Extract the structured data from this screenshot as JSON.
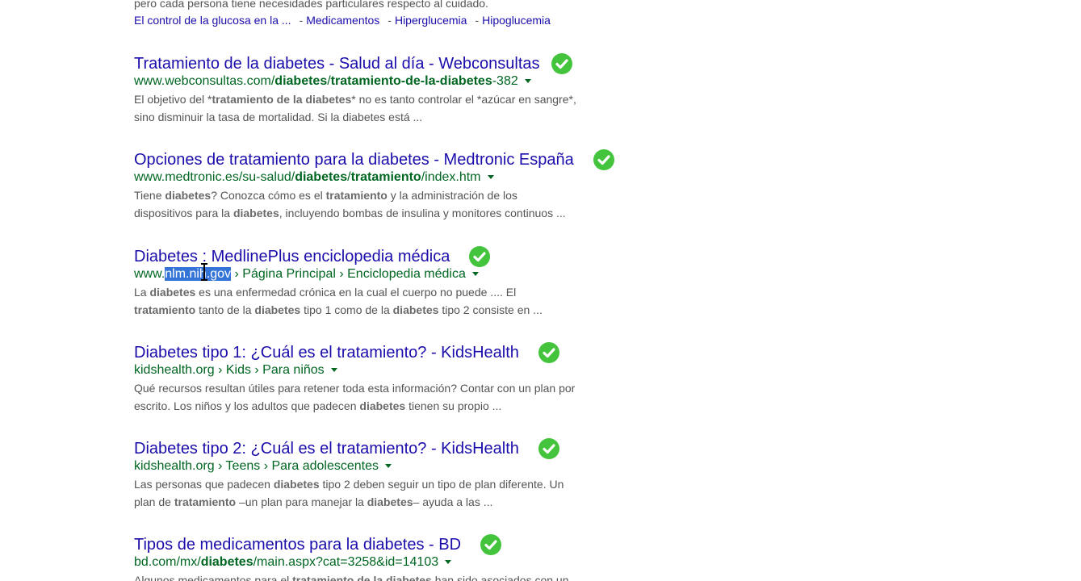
{
  "top_partial": {
    "snippet_line": "pero cada persona tiene necesidades particulares respecto al cuidado.",
    "sitelinks": [
      "El control de la glucosa en la ...",
      "Medicamentos",
      "Hiperglucemia",
      "Hipoglucemia"
    ]
  },
  "check_icon_color": "#44c43c",
  "results": [
    {
      "title": "Tratamiento de la diabetes - Salud al día - Webconsultas",
      "url": [
        {
          "t": "www.webconsultas.com/",
          "b": false
        },
        {
          "t": "diabetes",
          "b": true
        },
        {
          "t": "/",
          "b": false
        },
        {
          "t": "tratamiento-de-la-diabetes",
          "b": true
        },
        {
          "t": "-382",
          "b": false
        }
      ],
      "snippet": [
        [
          {
            "t": "El objetivo del *",
            "b": false
          },
          {
            "t": "tratamiento de la diabetes",
            "b": true
          },
          {
            "t": "* no es tanto controlar el *azúcar en sangre*,",
            "b": false
          }
        ],
        [
          {
            "t": "sino disminuir la tasa de mortalidad. Si la diabetes está ...",
            "b": false
          }
        ]
      ]
    },
    {
      "title": "Opciones de tratamiento para la diabetes - Medtronic España",
      "url": [
        {
          "t": "www.medtronic.es/su-salud/",
          "b": false
        },
        {
          "t": "diabetes",
          "b": true
        },
        {
          "t": "/",
          "b": false
        },
        {
          "t": "tratamiento",
          "b": true
        },
        {
          "t": "/index.htm",
          "b": false
        }
      ],
      "snippet": [
        [
          {
            "t": "Tiene ",
            "b": false
          },
          {
            "t": "diabetes",
            "b": true
          },
          {
            "t": "? Conozca cómo es el ",
            "b": false
          },
          {
            "t": "tratamiento",
            "b": true
          },
          {
            "t": " y la administración de los",
            "b": false
          }
        ],
        [
          {
            "t": "dispositivos para la ",
            "b": false
          },
          {
            "t": "diabetes",
            "b": true
          },
          {
            "t": ", incluyendo bombas de insulina y monitores continuos ...",
            "b": false
          }
        ]
      ]
    },
    {
      "title": "Diabetes : MedlinePlus enciclopedia médica",
      "url_prefix": "www.",
      "url_selected": "nlm.nih.gov",
      "url_crumbs": " › Página Principal › Enciclopedia médica",
      "snippet": [
        [
          {
            "t": "La ",
            "b": false
          },
          {
            "t": "diabetes",
            "b": true
          },
          {
            "t": " es una enfermedad crónica en la cual el cuerpo no puede .... El",
            "b": false
          }
        ],
        [
          {
            "t": "tratamiento",
            "b": true
          },
          {
            "t": " tanto de la ",
            "b": false
          },
          {
            "t": "diabetes",
            "b": true
          },
          {
            "t": " tipo 1 como de la ",
            "b": false
          },
          {
            "t": "diabetes",
            "b": true
          },
          {
            "t": " tipo 2 consiste en ...",
            "b": false
          }
        ]
      ]
    },
    {
      "title": "Diabetes tipo 1: ¿Cuál es el tratamiento? - KidsHealth",
      "url": [
        {
          "t": "kidshealth.org › Kids › Para niños",
          "b": false
        }
      ],
      "snippet": [
        [
          {
            "t": "Qué recursos resultan útiles para retener toda esta información? Contar con un plan por",
            "b": false
          }
        ],
        [
          {
            "t": "escrito. Los niños y los adultos que padecen ",
            "b": false
          },
          {
            "t": "diabetes",
            "b": true
          },
          {
            "t": " tienen su propio ...",
            "b": false
          }
        ]
      ]
    },
    {
      "title": "Diabetes tipo 2: ¿Cuál es el tratamiento? - KidsHealth",
      "url": [
        {
          "t": "kidshealth.org › Teens › Para adolescentes",
          "b": false
        }
      ],
      "snippet": [
        [
          {
            "t": "Las personas que padecen ",
            "b": false
          },
          {
            "t": "diabetes",
            "b": true
          },
          {
            "t": " tipo 2 deben seguir un tipo de plan diferente. Un",
            "b": false
          }
        ],
        [
          {
            "t": "plan de ",
            "b": false
          },
          {
            "t": "tratamiento",
            "b": true
          },
          {
            "t": " –un plan para manejar la ",
            "b": false
          },
          {
            "t": "diabetes",
            "b": true
          },
          {
            "t": "– ayuda a las ...",
            "b": false
          }
        ]
      ]
    },
    {
      "title": "Tipos de medicamentos para la diabetes - BD",
      "url": [
        {
          "t": "bd.com/mx/",
          "b": false
        },
        {
          "t": "diabetes",
          "b": true
        },
        {
          "t": "/main.aspx?cat=3258&id=14103",
          "b": false
        }
      ],
      "snippet": [
        [
          {
            "t": "Algunos medicamentos para el ",
            "b": false
          },
          {
            "t": "tratamiento de la diabetes",
            "b": true
          },
          {
            "t": " han sido asociados con un",
            "b": false
          }
        ]
      ]
    }
  ]
}
